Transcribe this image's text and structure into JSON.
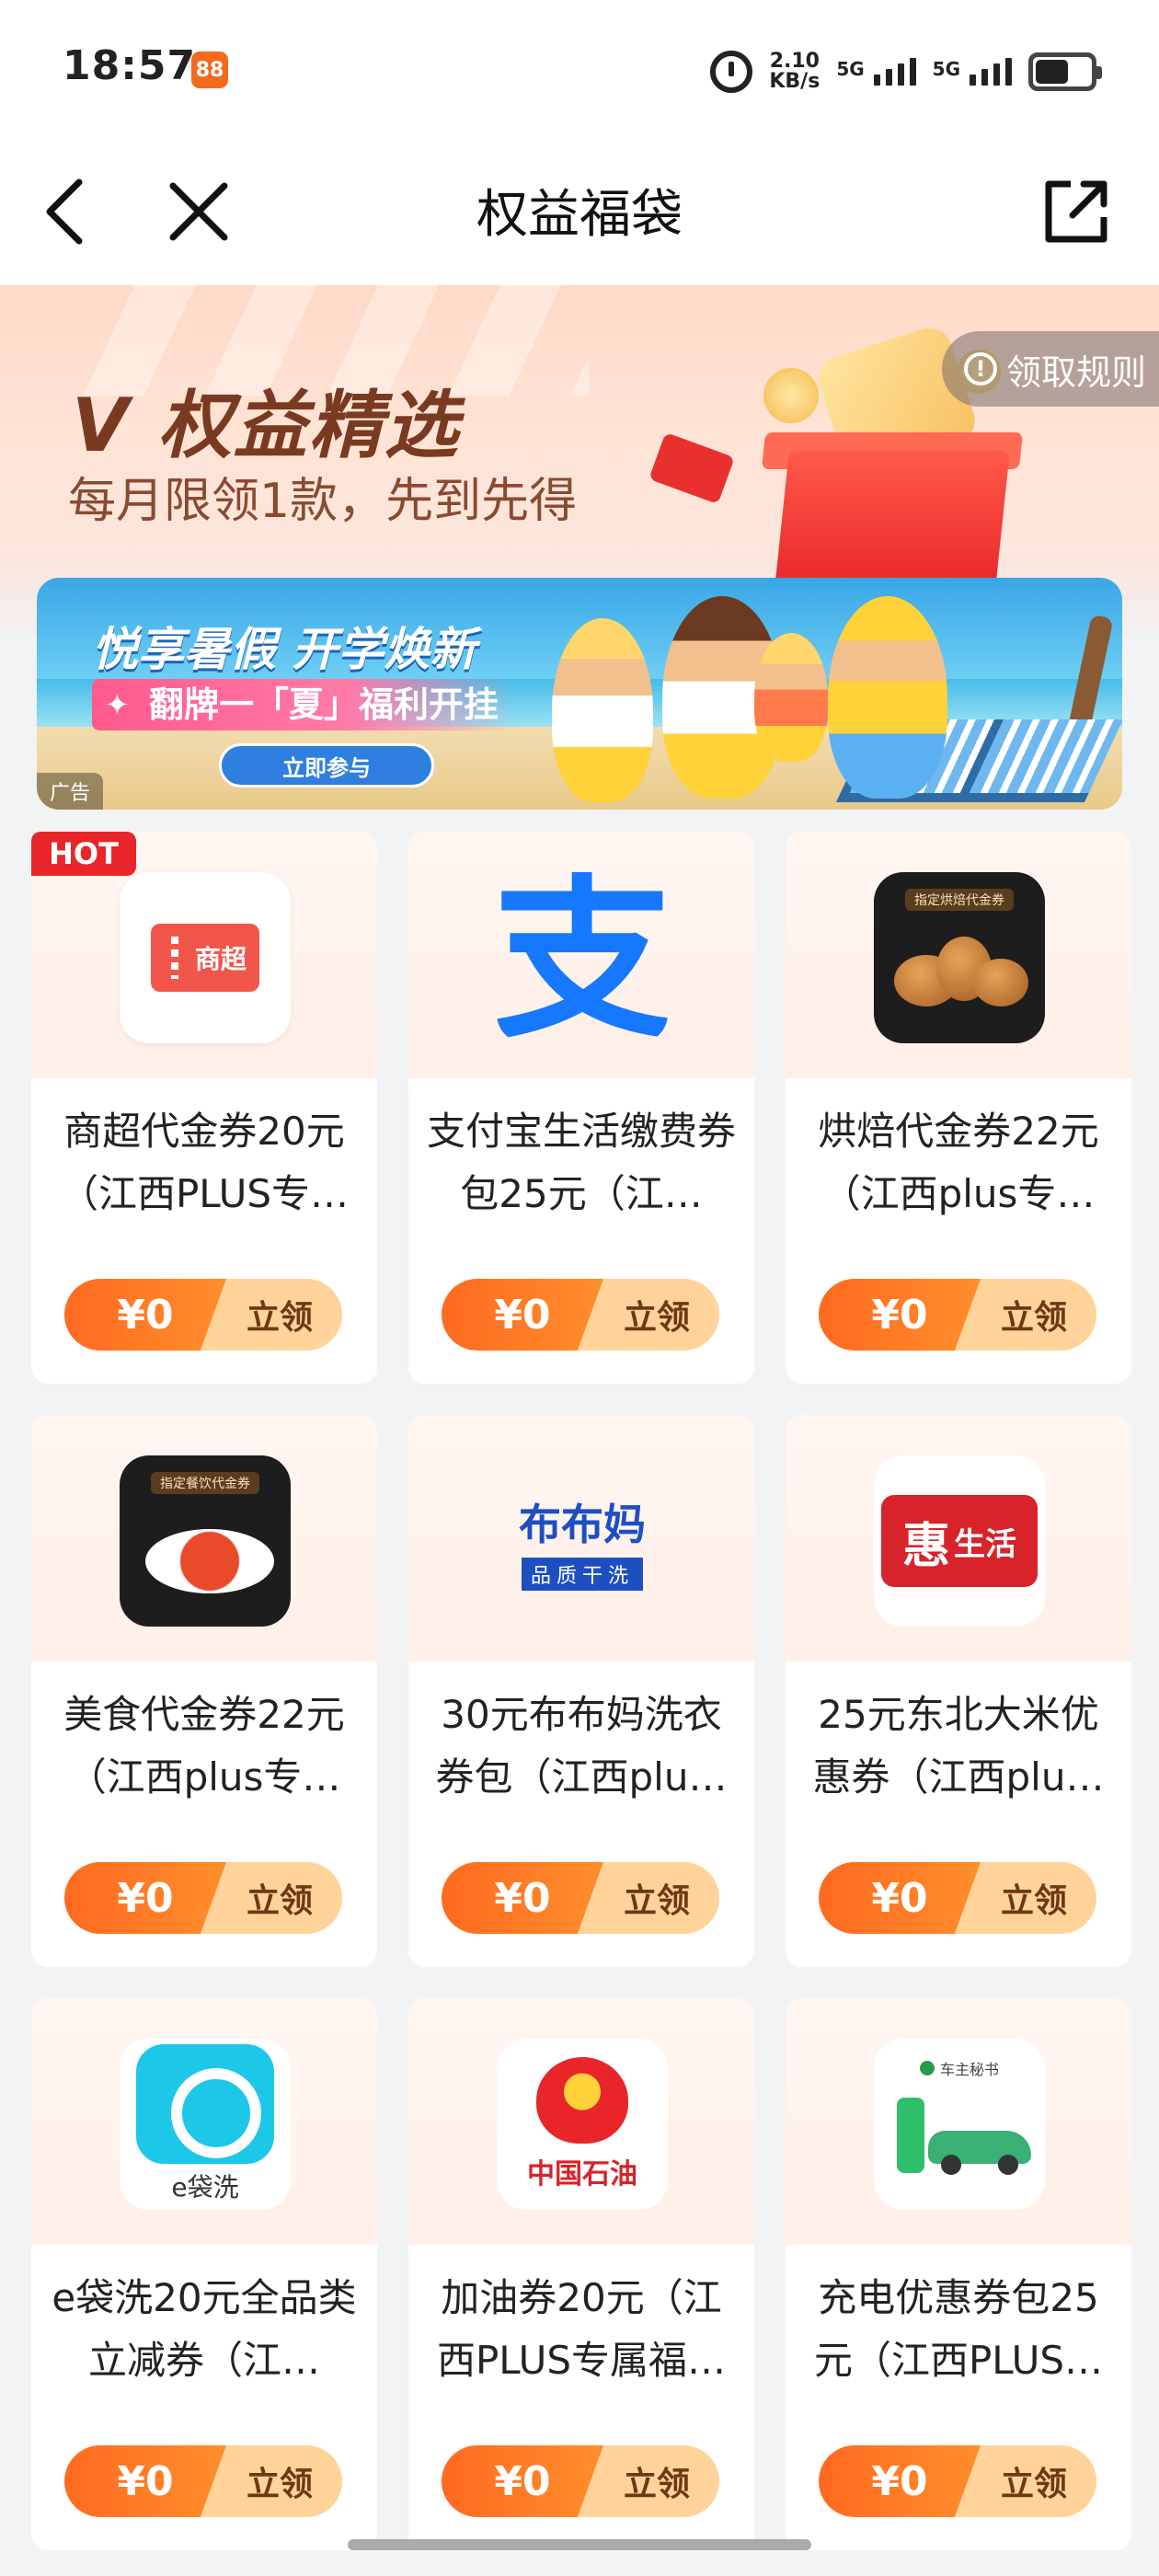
{
  "status_bar": {
    "time": "18:57",
    "app_badge": "88",
    "net_speed_value": "2.10",
    "net_speed_unit": "KB/s",
    "sim1": "5G",
    "sim2": "5G",
    "battery_level": 0.6
  },
  "nav": {
    "title": "权益福袋",
    "back_icon": "chevron-left-icon",
    "close_icon": "close-icon",
    "share_icon": "share-icon"
  },
  "hero": {
    "title": "V 权益精选",
    "subtitle": "每月限领1款，先到先得",
    "rules_label": "领取规则"
  },
  "ad": {
    "title": "悦享暑假 开学焕新",
    "subtitle": "翻牌一「夏」福利开挂",
    "cta": "立即参与",
    "tag": "广告"
  },
  "hot_badge": "HOT",
  "cards": [
    {
      "name": "商超代金券20元（江西PLUS专…",
      "price": "¥0",
      "action": "立领",
      "logo": "supermarket-voucher-icon",
      "logo_text": "商超"
    },
    {
      "name": "支付宝生活缴费券包25元（江…",
      "price": "¥0",
      "action": "立领",
      "logo": "alipay-icon",
      "logo_text": "支"
    },
    {
      "name": "烘焙代金券22元（江西plus专…",
      "price": "¥0",
      "action": "立领",
      "logo": "bakery-voucher-icon",
      "logo_text": "指定烘焙代金券"
    },
    {
      "name": "美食代金券22元（江西plus专…",
      "price": "¥0",
      "action": "立领",
      "logo": "food-voucher-icon",
      "logo_text": "指定餐饮代金券"
    },
    {
      "name": "30元布布妈洗衣券包（江西plu…",
      "price": "¥0",
      "action": "立领",
      "logo": "bubuma-laundry-icon",
      "logo_text": "布布妈",
      "logo_sub": "品质干洗"
    },
    {
      "name": "25元东北大米优惠券（江西plu…",
      "price": "¥0",
      "action": "立领",
      "logo": "huishenghuo-icon",
      "logo_text": "惠",
      "logo_sub": "生活"
    },
    {
      "name": "e袋洗20元全品类立减券（江…",
      "price": "¥0",
      "action": "立领",
      "logo": "edaixi-icon",
      "logo_text": "e袋洗"
    },
    {
      "name": "加油券20元（江西PLUS专属福…",
      "price": "¥0",
      "action": "立领",
      "logo": "petrochina-icon",
      "logo_text": "中国石油"
    },
    {
      "name": "充电优惠券包25元（江西PLUS…",
      "price": "¥0",
      "action": "立领",
      "logo": "ev-charging-icon",
      "logo_text": "车主秘书"
    }
  ],
  "colors": {
    "accent_orange": "#ff6a20",
    "claim_bg": "#ffd39a",
    "hot_red": "#e8262a",
    "alipay_blue": "#1677ff"
  }
}
